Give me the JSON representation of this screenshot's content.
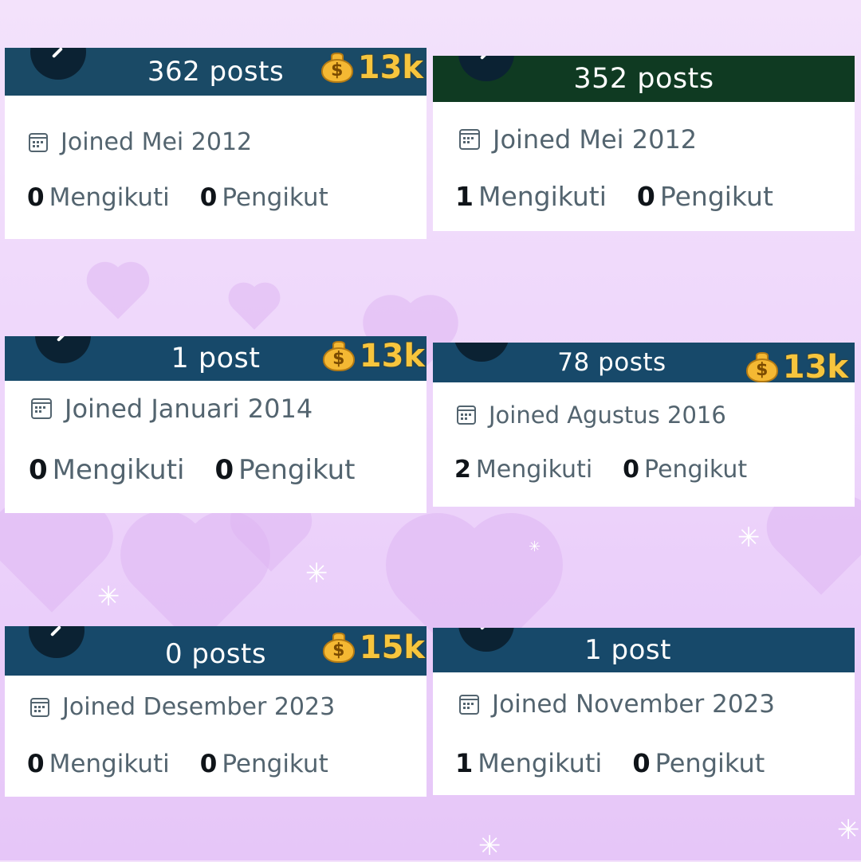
{
  "cards": [
    {
      "posts": "362 posts",
      "badge": "13k",
      "joined": "Joined Mei 2012",
      "following_count": "0",
      "following_label": "Mengikuti",
      "followers_count": "0",
      "followers_label": "Pengikut",
      "header_color": "#1a4a66"
    },
    {
      "posts": "352 posts",
      "badge": "",
      "joined": "Joined Mei 2012",
      "following_count": "1",
      "following_label": "Mengikuti",
      "followers_count": "0",
      "followers_label": "Pengikut",
      "header_color": "#0f3a22"
    },
    {
      "posts": "1 post",
      "badge": "13k",
      "joined": "Joined Januari 2014",
      "following_count": "0",
      "following_label": "Mengikuti",
      "followers_count": "0",
      "followers_label": "Pengikut",
      "header_color": "#17496a"
    },
    {
      "posts": "78 posts",
      "badge": "13k",
      "joined": "Joined Agustus 2016",
      "following_count": "2",
      "following_label": "Mengikuti",
      "followers_count": "0",
      "followers_label": "Pengikut",
      "header_color": "#17496a"
    },
    {
      "posts": "0 posts",
      "badge": "15k",
      "joined": "Joined Desember 2023",
      "following_count": "0",
      "following_label": "Mengikuti",
      "followers_count": "0",
      "followers_label": "Pengikut",
      "header_color": "#17496a"
    },
    {
      "posts": "1 post",
      "badge": "",
      "joined": "Joined November 2023",
      "following_count": "1",
      "following_label": "Mengikuti",
      "followers_count": "0",
      "followers_label": "Pengikut",
      "header_color": "#17496a"
    }
  ],
  "icons": {
    "back": "back-arrow-icon",
    "calendar": "calendar-icon",
    "money_bag": "money-bag-icon"
  },
  "colors": {
    "text_muted": "#53646f",
    "text_strong": "#0f1419",
    "badge_gold": "#f7c53d",
    "background": "#eed6fb"
  }
}
